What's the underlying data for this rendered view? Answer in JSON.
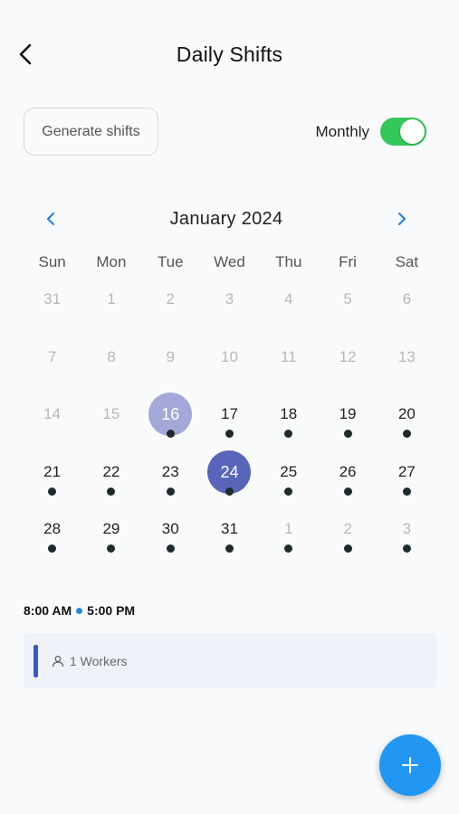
{
  "header": {
    "title": "Daily Shifts"
  },
  "toolbar": {
    "generate_label": "Generate shifts",
    "toggle_label": "Monthly",
    "toggle_on": true
  },
  "calendar": {
    "month_label": "January 2024",
    "weekdays": [
      "Sun",
      "Mon",
      "Tue",
      "Wed",
      "Thu",
      "Fri",
      "Sat"
    ],
    "weeks": [
      [
        {
          "n": "31",
          "m": true
        },
        {
          "n": "1",
          "m": true
        },
        {
          "n": "2",
          "m": true
        },
        {
          "n": "3",
          "m": true
        },
        {
          "n": "4",
          "m": true
        },
        {
          "n": "5",
          "m": true
        },
        {
          "n": "6",
          "m": true
        }
      ],
      [
        {
          "n": "7",
          "m": true
        },
        {
          "n": "8",
          "m": true
        },
        {
          "n": "9",
          "m": true
        },
        {
          "n": "10",
          "m": true
        },
        {
          "n": "11",
          "m": true
        },
        {
          "n": "12",
          "m": true
        },
        {
          "n": "13",
          "m": true
        }
      ],
      [
        {
          "n": "14",
          "m": true
        },
        {
          "n": "15",
          "m": true
        },
        {
          "n": "16",
          "s": "light",
          "d": true
        },
        {
          "n": "17",
          "d": true
        },
        {
          "n": "18",
          "d": true
        },
        {
          "n": "19",
          "d": true
        },
        {
          "n": "20",
          "d": true
        }
      ],
      [
        {
          "n": "21",
          "d": true
        },
        {
          "n": "22",
          "d": true
        },
        {
          "n": "23",
          "d": true
        },
        {
          "n": "24",
          "s": "dark",
          "d": true
        },
        {
          "n": "25",
          "d": true
        },
        {
          "n": "26",
          "d": true
        },
        {
          "n": "27",
          "d": true
        }
      ],
      [
        {
          "n": "28",
          "d": true
        },
        {
          "n": "29",
          "d": true
        },
        {
          "n": "30",
          "d": true
        },
        {
          "n": "31",
          "d": true
        },
        {
          "n": "1",
          "m": true,
          "d": true
        },
        {
          "n": "2",
          "m": true,
          "d": true
        },
        {
          "n": "3",
          "m": true,
          "d": true
        }
      ]
    ]
  },
  "shift": {
    "start": "8:00 AM",
    "end": "5:00 PM",
    "workers_label": "1 Workers"
  },
  "colors": {
    "accent": "#2196f3",
    "toggle_on": "#34c759",
    "selected_light": "#a4a8d8",
    "selected_dark": "#5865b8",
    "card_bar": "#4057b8"
  }
}
